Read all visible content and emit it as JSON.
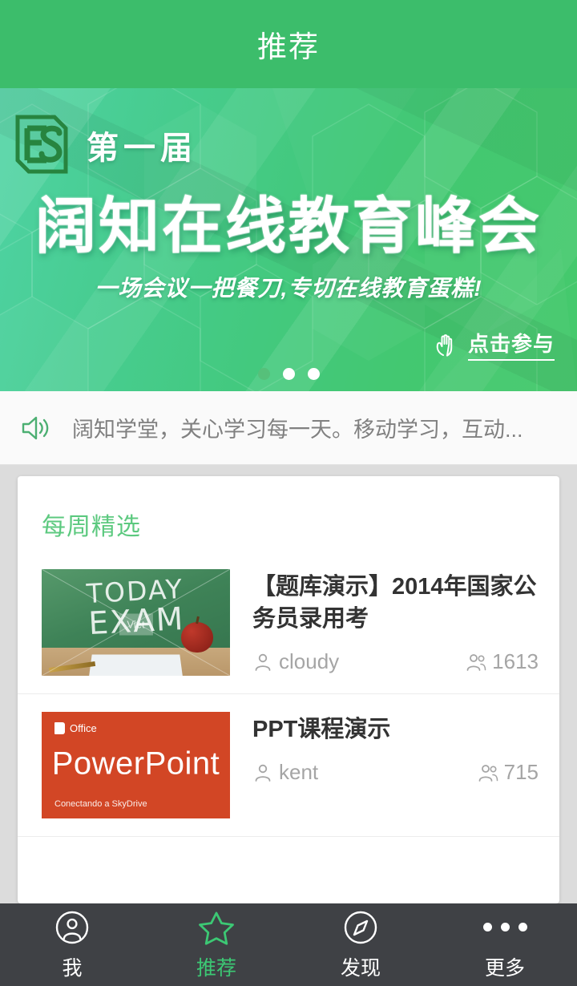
{
  "header": {
    "title": "推荐",
    "bg_color": "#3cbd6b"
  },
  "banner": {
    "logo_text": "ES",
    "kicker": "第一届",
    "title": "阔知在线教育峰会",
    "subtitle": "一场会议一把餐刀,专切在线教育蛋糕!",
    "cta_label": "点击参与",
    "cta_icon": "pointing-hand-icon",
    "dots_total": 3,
    "dots_active_index": 0,
    "gradient_from": "#4fd3a4",
    "gradient_to": "#45c96c"
  },
  "announcement": {
    "icon": "speaker-icon",
    "icon_color": "#4caf72",
    "text": "阔知学堂，关心学习每一天。移动学习，互动..."
  },
  "weekly": {
    "section_title": "每周精选",
    "section_title_color": "#5cc97f",
    "items": [
      {
        "title": "【题库演示】2014年国家公务员录用考",
        "author": "cloudy",
        "author_icon": "person-icon",
        "views": "1613",
        "views_icon": "people-icon",
        "thumb_kind": "chalkboard",
        "thumb_text_line1": "TODAY",
        "thumb_text_line2": "EXAM",
        "thumb_watermark": "Viet"
      },
      {
        "title": "PPT课程演示",
        "author": "kent",
        "author_icon": "person-icon",
        "views": "715",
        "views_icon": "people-icon",
        "thumb_kind": "powerpoint",
        "thumb_brand": "Office",
        "thumb_app_name": "PowerPoint",
        "thumb_footnote": "Conectando a SkyDrive",
        "thumb_color": "#d24625"
      }
    ]
  },
  "tabbar": {
    "bg_color": "#3f4145",
    "active_color": "#3cc874",
    "tabs": [
      {
        "label": "我",
        "icon": "person-circle-icon",
        "active": false
      },
      {
        "label": "推荐",
        "icon": "star-icon",
        "active": true
      },
      {
        "label": "发现",
        "icon": "compass-icon",
        "active": false
      },
      {
        "label": "更多",
        "icon": "more-dots-icon",
        "active": false
      }
    ]
  }
}
